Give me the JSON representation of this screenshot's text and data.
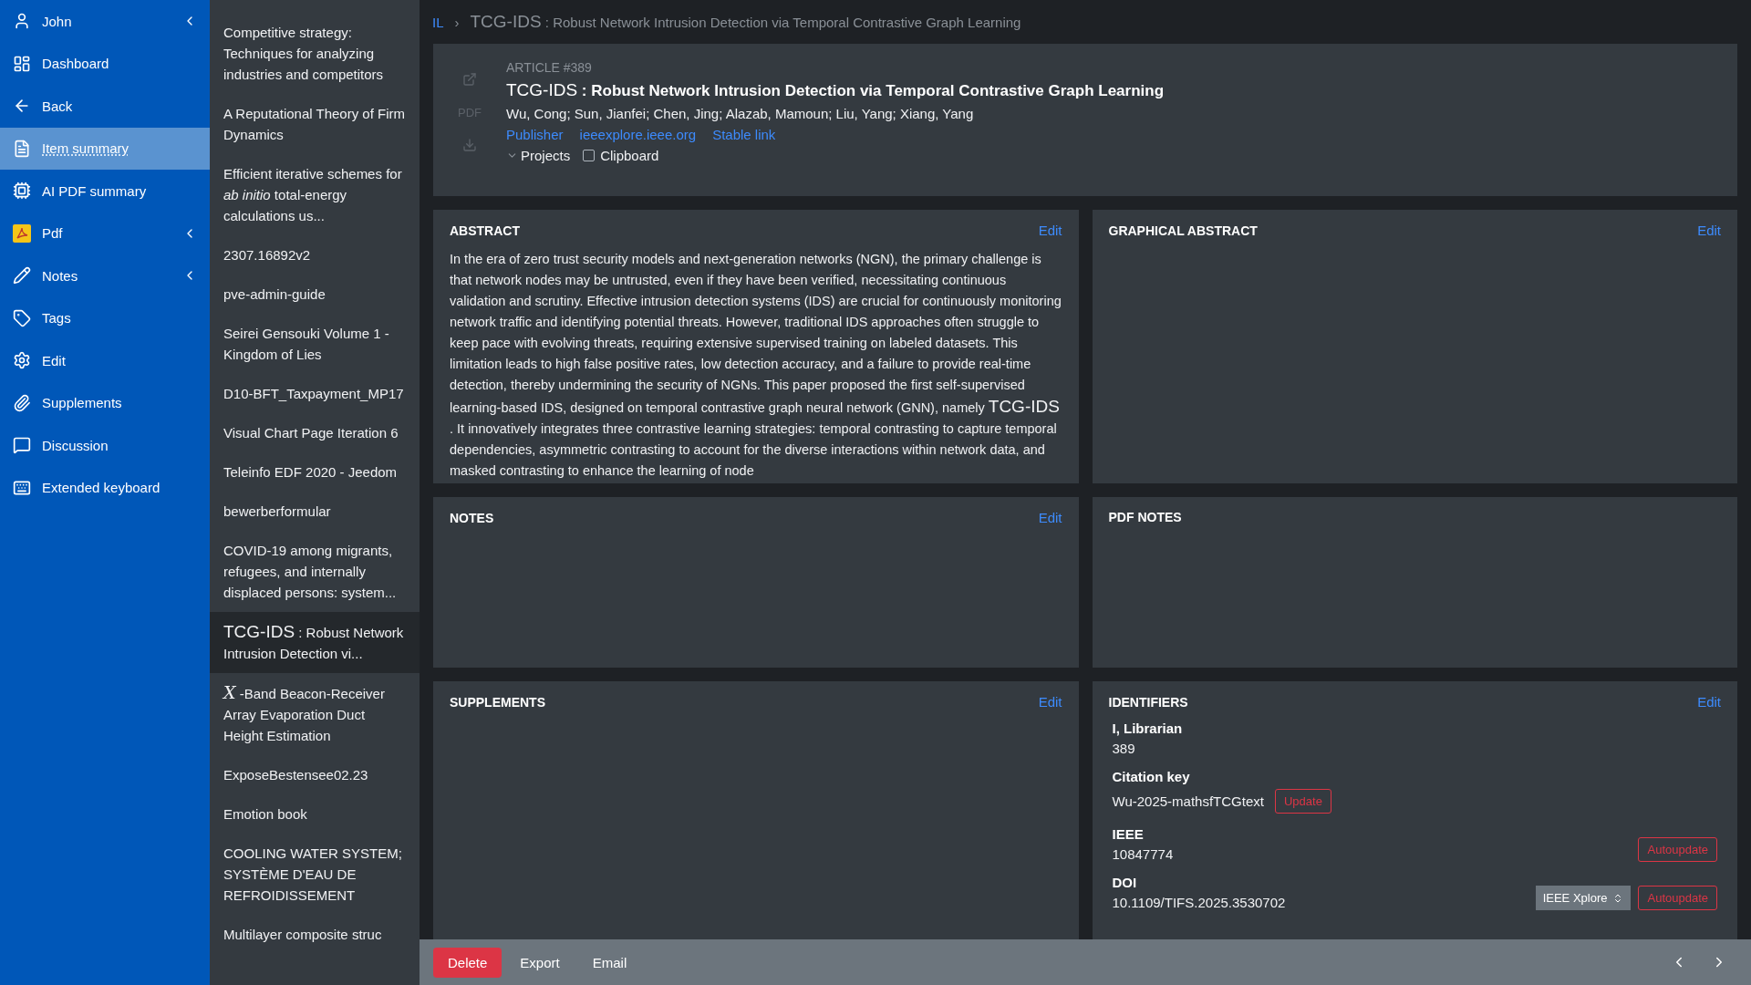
{
  "sidebar": {
    "items": [
      {
        "label": "John",
        "expandable": true,
        "selected": false
      },
      {
        "label": "Dashboard",
        "expandable": false,
        "selected": false
      },
      {
        "label": "Back",
        "expandable": false,
        "selected": false
      },
      {
        "label": "Item summary",
        "expandable": false,
        "selected": true
      },
      {
        "label": "AI PDF summary",
        "expandable": false,
        "selected": false
      },
      {
        "label": "Pdf",
        "expandable": true,
        "selected": false
      },
      {
        "label": "Notes",
        "expandable": true,
        "selected": false
      },
      {
        "label": "Tags",
        "expandable": false,
        "selected": false
      },
      {
        "label": "Edit",
        "expandable": false,
        "selected": false
      },
      {
        "label": "Supplements",
        "expandable": false,
        "selected": false
      },
      {
        "label": "Discussion",
        "expandable": false,
        "selected": false
      },
      {
        "label": "Extended keyboard",
        "expandable": false,
        "selected": false
      }
    ]
  },
  "item_list": [
    {
      "kind": "text",
      "text": "Competitive strategy: Techniques for analyzing industries and competitors",
      "selected": false
    },
    {
      "kind": "text",
      "text": "A Reputational Theory of Firm Dynamics",
      "selected": false
    },
    {
      "kind": "text",
      "text": "Efficient iterative schemes for *ab initio* total-energy calculations us...",
      "selected": false
    },
    {
      "kind": "text",
      "text": "2307.16892v2",
      "selected": false
    },
    {
      "kind": "text",
      "text": "pve-admin-guide",
      "selected": false
    },
    {
      "kind": "text",
      "text": "Seirei Gensouki Volume 1 - Kingdom of Lies",
      "selected": false
    },
    {
      "kind": "text",
      "text": "D10-BFT_Taxpayment_MP17",
      "selected": false
    },
    {
      "kind": "text",
      "text": "Visual Chart Page Iteration 6",
      "selected": false
    },
    {
      "kind": "text",
      "text": "Teleinfo EDF 2020 - Jeedom",
      "selected": false
    },
    {
      "kind": "text",
      "text": "bewerberformular",
      "selected": false
    },
    {
      "kind": "text",
      "text": "COVID-19 among migrants, refugees, and internally displaced persons: system...",
      "selected": false
    },
    {
      "kind": "term",
      "term": "TCG-IDS",
      "text": ": Robust Network Intrusion Detection vi...",
      "selected": true
    },
    {
      "kind": "math",
      "term": "X",
      "text": "-Band Beacon-Receiver Array Evaporation Duct Height Estimation",
      "selected": false
    },
    {
      "kind": "text",
      "text": "ExposeBestensee02.23",
      "selected": false
    },
    {
      "kind": "text",
      "text": "Emotion book",
      "selected": false
    },
    {
      "kind": "text",
      "text": "COOLING WATER SYSTEM; SYSTÈME D'EAU DE REFROIDISSEMENT",
      "selected": false
    },
    {
      "kind": "text",
      "text": "Multilayer composite struc",
      "selected": false
    }
  ],
  "breadcrumb": {
    "root": "IL",
    "separator": "›",
    "term": "TCG-IDS",
    "text": ": Robust Network Intrusion Detection via Temporal Contrastive Graph Learning"
  },
  "article": {
    "side_actions": [
      {
        "kind": "open"
      },
      {
        "kind": "pdf",
        "label": "PDF"
      },
      {
        "kind": "download"
      }
    ],
    "label": "ARTICLE #389",
    "term": "TCG-IDS",
    "title": ": Robust Network Intrusion Detection via Temporal Contrastive Graph Learning",
    "authors": "Wu, Cong; Sun, Jianfei; Chen, Jing; Alazab, Mamoun; Liu, Yang; Xiang, Yang",
    "links": [
      "Publisher",
      "ieeexplore.ieee.org",
      "Stable link"
    ],
    "projects": {
      "label": "Projects",
      "expanded": false
    },
    "clipboard": {
      "label": "Clipboard",
      "checked": false
    }
  },
  "cards": [
    {
      "kind": "abstract",
      "title": "ABSTRACT",
      "edit": "Edit",
      "text_before": "In the era of zero trust security models and next-generation networks (NGN), the primary challenge is that network nodes may be untrusted, even if they have been verified, necessitating continuous validation and scrutiny. Effective intrusion detection systems (IDS) are crucial for continuously monitoring network traffic and identifying potential threats. However, traditional IDS approaches often struggle to keep pace with evolving threats, requiring extensive supervised training on labeled datasets. This limitation leads to high false positive rates, low detection accuracy, and a failure to provide real-time detection, thereby undermining the security of NGNs. This paper proposed the first self-supervised learning-based IDS, designed on temporal contrastive graph neural network (GNN), namely",
      "term": "TCG-IDS",
      "text_after": ". It innovatively integrates three contrastive learning strategies: temporal contrasting to capture temporal dependencies, asymmetric contrasting to account for the diverse interactions within network data, and masked contrasting to enhance the learning of node"
    },
    {
      "kind": "empty",
      "title": "GRAPHICAL ABSTRACT",
      "edit": "Edit"
    },
    {
      "kind": "empty",
      "title": "NOTES",
      "edit": "Edit"
    },
    {
      "kind": "empty",
      "title": "PDF NOTES"
    },
    {
      "kind": "empty",
      "title": "SUPPLEMENTS",
      "edit": "Edit"
    },
    {
      "kind": "identifiers",
      "title": "IDENTIFIERS",
      "edit": "Edit",
      "fields": [
        {
          "label": "I, Librarian",
          "value": "389"
        },
        {
          "label": "Citation key",
          "value": "Wu-2025-mathsfTCGtext",
          "inline_button": "Update"
        },
        {
          "label": "IEEE",
          "value": "10847774",
          "buttons": [
            "Autoupdate"
          ]
        },
        {
          "label": "DOI",
          "value": "10.1109/TIFS.2025.3530702",
          "select": "IEEE Xplore",
          "buttons": [
            "Autoupdate"
          ]
        }
      ]
    }
  ],
  "bottom_bar": {
    "buttons": [
      {
        "label": "Delete",
        "kind": "danger"
      },
      {
        "label": "Export",
        "kind": "plain"
      },
      {
        "label": "Email",
        "kind": "plain"
      }
    ]
  }
}
